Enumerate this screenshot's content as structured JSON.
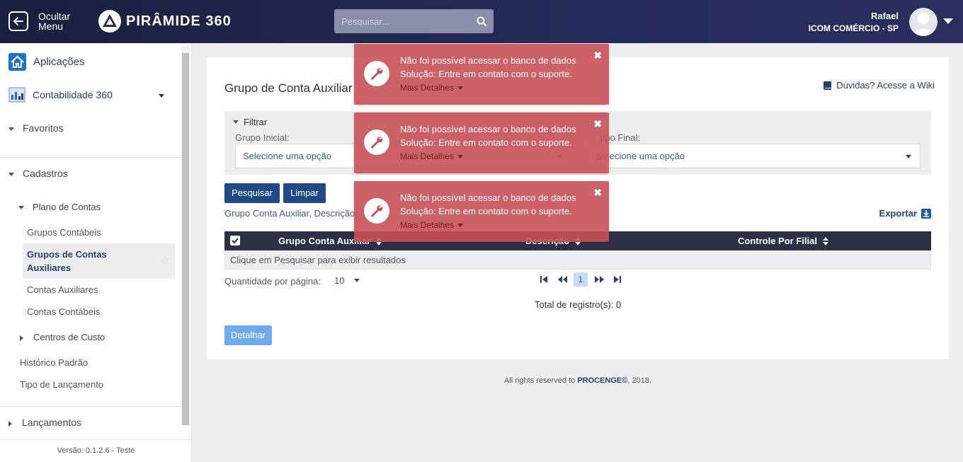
{
  "header": {
    "hide_menu_label_1": "Ocultar",
    "hide_menu_label_2": "Menu",
    "brand_name": "PIRÂMIDE 360",
    "search_placeholder": "Pesquisar...",
    "user_name": "Rafael",
    "user_company": "ICOM COMÉRCIO - SP"
  },
  "sidebar": {
    "apps_label": "Aplicações",
    "module_label": "Contabilidade 360",
    "favorites": "Favoritos",
    "cadastros": "Cadastros",
    "plano_de_contas": "Plano de Contas",
    "grupos_contabeis": "Grupos Contábeis",
    "grupos_auxiliares_1": "Grupos de Contas",
    "grupos_auxiliares_2": "Auxiliares",
    "contas_auxiliares": "Contas Auxiliares",
    "contas_contabeis": "Contas Contábeis",
    "centros_de_custo": "Centros de Custo",
    "historico_padrao": "Histórico Padrão",
    "tipo_lancamento": "Tipo de Lançamento",
    "lancamentos": "Lançamentos",
    "version": "Versão: 0.1.2.6 - Teste"
  },
  "main": {
    "title": "Grupo de Conta Auxiliar",
    "wiki_link": "Dúvidas? Acesse a Wiki",
    "filter_label": "Filtrar",
    "grupo_inicial_label": "Grupo Inicial:",
    "grupo_inicial_value": "Selecione uma opção",
    "grupo_final_label": "upo Final:",
    "grupo_final_value": "Selecione uma opção",
    "search_button": "Pesquisar",
    "clear_button": "Limpar",
    "columns_link": "Grupo Conta Auxiliar, Descrição,",
    "export_link": "Exportar",
    "columns": [
      "Grupo Conta Auxiliar",
      "Descrição",
      "Controle Por Filial"
    ],
    "empty_message": "Clique em Pesquisar para exibir resultados",
    "per_page_label": "Quantidade por página:",
    "per_page_value": "10",
    "current_page": "1",
    "total_records": "Total de registro(s): 0",
    "detail_button": "Detalhar"
  },
  "footer": {
    "prefix": "All rights reserved to ",
    "company": "PROCENGE©",
    "suffix": ", 2018."
  },
  "toasts": [
    {
      "line1": "Não foi possível acessar o banco de dados",
      "line2": "Solução: Entre em contato com o suporte.",
      "details": "Mais Detalhes"
    },
    {
      "line1": "Não foi possível acessar o banco de dados",
      "line2": "Solução: Entre em contato com o suporte.",
      "details": "Mais Detalhes"
    },
    {
      "line1": "Não foi possível acessar o banco de dados",
      "line2": "Solução: Entre em contato com o suporte.",
      "details": "Mais Detalhes"
    }
  ],
  "colors": {
    "topbar": "#1a1f3f",
    "primary_button": "#1f4a87",
    "toast": "#c65056",
    "link": "#23426e"
  },
  "icons": {
    "hide_menu": "arrow-left-box-icon",
    "search": "search-icon",
    "home": "home-icon",
    "module": "chart-building-icon",
    "book": "book-icon",
    "export": "download-icon",
    "toast": "wrench-icon",
    "close": "close-icon"
  }
}
